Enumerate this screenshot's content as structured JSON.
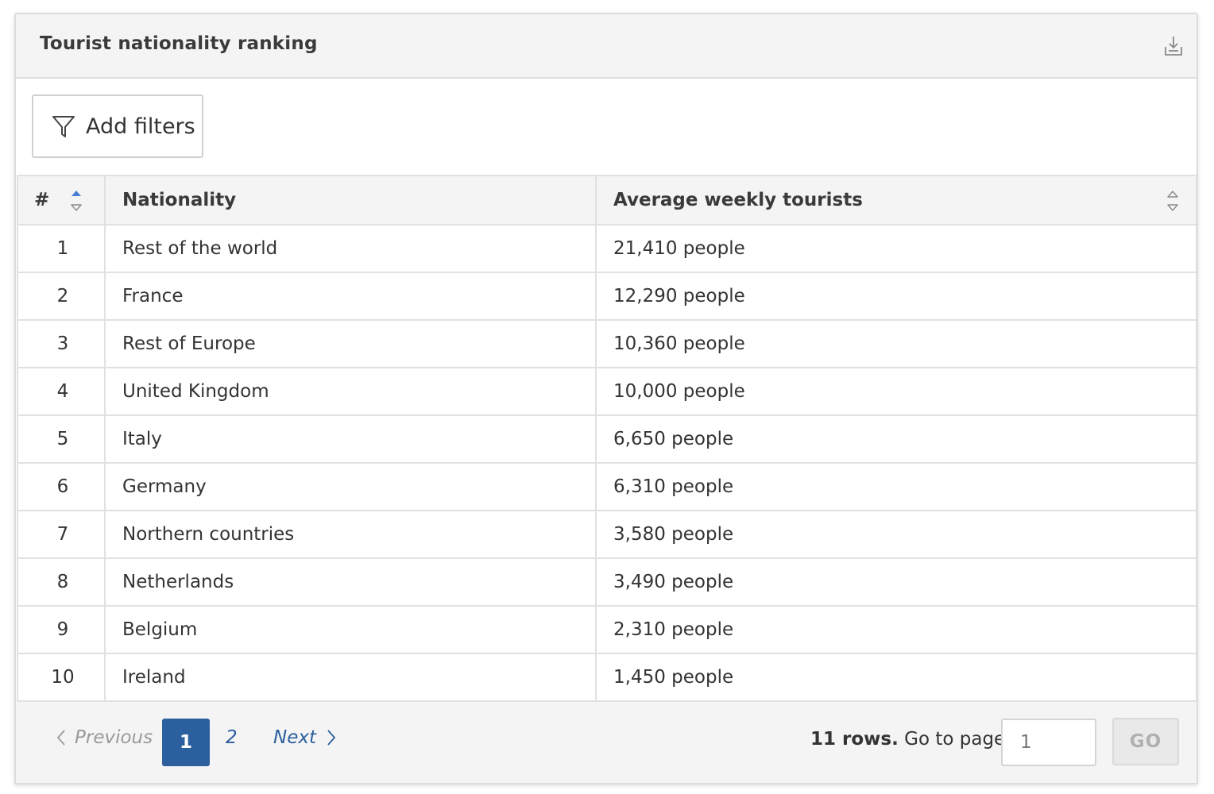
{
  "panel": {
    "title": "Tourist nationality ranking",
    "download_icon": "download-icon"
  },
  "filters": {
    "add_label": "Add filters",
    "icon": "funnel-icon"
  },
  "table": {
    "columns": [
      "#",
      "Nationality",
      "Average weekly tourists"
    ],
    "sorted_column": "#",
    "sort_direction": "ascending",
    "rows": [
      {
        "rank": "1",
        "nationality": "Rest of the world",
        "tourists": "21,410 people"
      },
      {
        "rank": "2",
        "nationality": "France",
        "tourists": "12,290 people"
      },
      {
        "rank": "3",
        "nationality": "Rest of Europe",
        "tourists": "10,360 people"
      },
      {
        "rank": "4",
        "nationality": "United Kingdom",
        "tourists": "10,000 people"
      },
      {
        "rank": "5",
        "nationality": "Italy",
        "tourists": "6,650 people"
      },
      {
        "rank": "6",
        "nationality": "Germany",
        "tourists": "6,310 people"
      },
      {
        "rank": "7",
        "nationality": "Northern countries",
        "tourists": "3,580 people"
      },
      {
        "rank": "8",
        "nationality": "Netherlands",
        "tourists": "3,490 people"
      },
      {
        "rank": "9",
        "nationality": "Belgium",
        "tourists": "2,310 people"
      },
      {
        "rank": "10",
        "nationality": "Ireland",
        "tourists": "1,450 people"
      }
    ]
  },
  "pagination": {
    "previous_label": "Previous",
    "current_page": "1",
    "next_page": "2",
    "next_label": "Next",
    "row_count": "11 rows.",
    "goto_label": "Go to page:",
    "goto_placeholder": "1",
    "go_label": "GO"
  },
  "colors": {
    "accent": "#2c5f9e",
    "sort_active": "#4a7fd4",
    "header_bg": "#f4f4f4",
    "border": "#e1e1e1"
  }
}
